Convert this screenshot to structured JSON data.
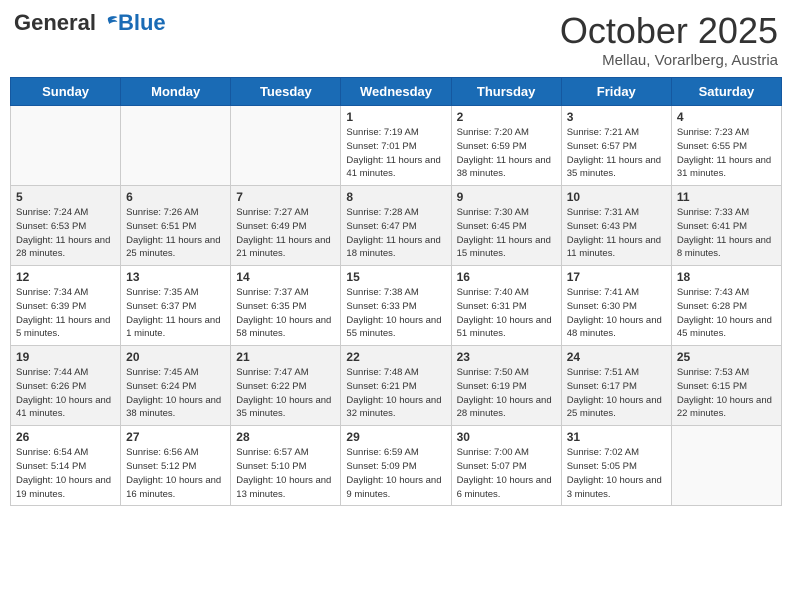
{
  "header": {
    "logo_general": "General",
    "logo_blue": "Blue",
    "month_title": "October 2025",
    "subtitle": "Mellau, Vorarlberg, Austria"
  },
  "weekdays": [
    "Sunday",
    "Monday",
    "Tuesday",
    "Wednesday",
    "Thursday",
    "Friday",
    "Saturday"
  ],
  "rows": [
    {
      "cells": [
        {
          "day": "",
          "empty": true
        },
        {
          "day": "",
          "empty": true
        },
        {
          "day": "",
          "empty": true
        },
        {
          "day": "1",
          "sunrise": "7:19 AM",
          "sunset": "7:01 PM",
          "daylight": "11 hours and 41 minutes."
        },
        {
          "day": "2",
          "sunrise": "7:20 AM",
          "sunset": "6:59 PM",
          "daylight": "11 hours and 38 minutes."
        },
        {
          "day": "3",
          "sunrise": "7:21 AM",
          "sunset": "6:57 PM",
          "daylight": "11 hours and 35 minutes."
        },
        {
          "day": "4",
          "sunrise": "7:23 AM",
          "sunset": "6:55 PM",
          "daylight": "11 hours and 31 minutes."
        }
      ]
    },
    {
      "cells": [
        {
          "day": "5",
          "sunrise": "7:24 AM",
          "sunset": "6:53 PM",
          "daylight": "11 hours and 28 minutes."
        },
        {
          "day": "6",
          "sunrise": "7:26 AM",
          "sunset": "6:51 PM",
          "daylight": "11 hours and 25 minutes."
        },
        {
          "day": "7",
          "sunrise": "7:27 AM",
          "sunset": "6:49 PM",
          "daylight": "11 hours and 21 minutes."
        },
        {
          "day": "8",
          "sunrise": "7:28 AM",
          "sunset": "6:47 PM",
          "daylight": "11 hours and 18 minutes."
        },
        {
          "day": "9",
          "sunrise": "7:30 AM",
          "sunset": "6:45 PM",
          "daylight": "11 hours and 15 minutes."
        },
        {
          "day": "10",
          "sunrise": "7:31 AM",
          "sunset": "6:43 PM",
          "daylight": "11 hours and 11 minutes."
        },
        {
          "day": "11",
          "sunrise": "7:33 AM",
          "sunset": "6:41 PM",
          "daylight": "11 hours and 8 minutes."
        }
      ]
    },
    {
      "cells": [
        {
          "day": "12",
          "sunrise": "7:34 AM",
          "sunset": "6:39 PM",
          "daylight": "11 hours and 5 minutes."
        },
        {
          "day": "13",
          "sunrise": "7:35 AM",
          "sunset": "6:37 PM",
          "daylight": "11 hours and 1 minute."
        },
        {
          "day": "14",
          "sunrise": "7:37 AM",
          "sunset": "6:35 PM",
          "daylight": "10 hours and 58 minutes."
        },
        {
          "day": "15",
          "sunrise": "7:38 AM",
          "sunset": "6:33 PM",
          "daylight": "10 hours and 55 minutes."
        },
        {
          "day": "16",
          "sunrise": "7:40 AM",
          "sunset": "6:31 PM",
          "daylight": "10 hours and 51 minutes."
        },
        {
          "day": "17",
          "sunrise": "7:41 AM",
          "sunset": "6:30 PM",
          "daylight": "10 hours and 48 minutes."
        },
        {
          "day": "18",
          "sunrise": "7:43 AM",
          "sunset": "6:28 PM",
          "daylight": "10 hours and 45 minutes."
        }
      ]
    },
    {
      "cells": [
        {
          "day": "19",
          "sunrise": "7:44 AM",
          "sunset": "6:26 PM",
          "daylight": "10 hours and 41 minutes."
        },
        {
          "day": "20",
          "sunrise": "7:45 AM",
          "sunset": "6:24 PM",
          "daylight": "10 hours and 38 minutes."
        },
        {
          "day": "21",
          "sunrise": "7:47 AM",
          "sunset": "6:22 PM",
          "daylight": "10 hours and 35 minutes."
        },
        {
          "day": "22",
          "sunrise": "7:48 AM",
          "sunset": "6:21 PM",
          "daylight": "10 hours and 32 minutes."
        },
        {
          "day": "23",
          "sunrise": "7:50 AM",
          "sunset": "6:19 PM",
          "daylight": "10 hours and 28 minutes."
        },
        {
          "day": "24",
          "sunrise": "7:51 AM",
          "sunset": "6:17 PM",
          "daylight": "10 hours and 25 minutes."
        },
        {
          "day": "25",
          "sunrise": "7:53 AM",
          "sunset": "6:15 PM",
          "daylight": "10 hours and 22 minutes."
        }
      ]
    },
    {
      "cells": [
        {
          "day": "26",
          "sunrise": "6:54 AM",
          "sunset": "5:14 PM",
          "daylight": "10 hours and 19 minutes."
        },
        {
          "day": "27",
          "sunrise": "6:56 AM",
          "sunset": "5:12 PM",
          "daylight": "10 hours and 16 minutes."
        },
        {
          "day": "28",
          "sunrise": "6:57 AM",
          "sunset": "5:10 PM",
          "daylight": "10 hours and 13 minutes."
        },
        {
          "day": "29",
          "sunrise": "6:59 AM",
          "sunset": "5:09 PM",
          "daylight": "10 hours and 9 minutes."
        },
        {
          "day": "30",
          "sunrise": "7:00 AM",
          "sunset": "5:07 PM",
          "daylight": "10 hours and 6 minutes."
        },
        {
          "day": "31",
          "sunrise": "7:02 AM",
          "sunset": "5:05 PM",
          "daylight": "10 hours and 3 minutes."
        },
        {
          "day": "",
          "empty": true
        }
      ]
    }
  ],
  "labels": {
    "sunrise_prefix": "Sunrise: ",
    "sunset_prefix": "Sunset: ",
    "daylight_prefix": "Daylight: "
  }
}
